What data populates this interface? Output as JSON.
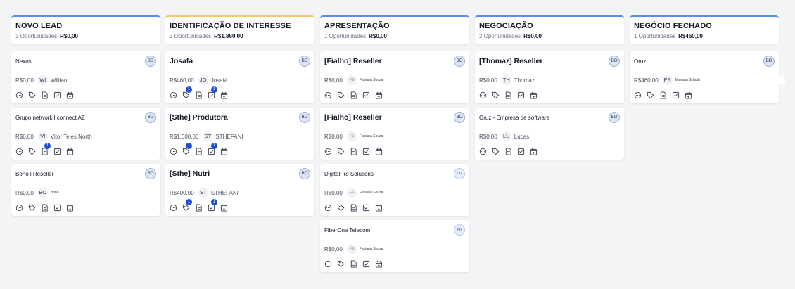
{
  "columns": [
    {
      "title": "NOVO LEAD",
      "count": "3 Oportunidades",
      "total": "R$0,00",
      "cards": [
        {
          "title": "Nexus",
          "big": false,
          "owner": "BD",
          "value": "R$0,00",
          "initials": "WI",
          "person": "Willian",
          "small": false,
          "badges": {}
        },
        {
          "title": "Grupo network l connect AZ",
          "big": false,
          "owner": "BD",
          "value": "R$0,00",
          "initials": "VI",
          "person": "Vitor Teles North",
          "small": false,
          "badges": {
            "doc": "1"
          }
        },
        {
          "title": "Bono l Reseller",
          "big": false,
          "owner": "BD",
          "value": "R$0,00",
          "initials": "BO",
          "person": "Bono",
          "small": false,
          "personSmall": true,
          "badges": {}
        }
      ]
    },
    {
      "title": "IDENTIFICAÇÃO DE INTERESSE",
      "count": "3 Oportunidades",
      "total": "R$1.860,00",
      "cards": [
        {
          "title": "Josafá",
          "big": true,
          "owner": "BD",
          "value": "R$460,00",
          "initials": "JO",
          "person": "Josafá",
          "small": false,
          "badges": {
            "tag": "1",
            "check": "1"
          }
        },
        {
          "title": "[Sthe] Produtora",
          "big": true,
          "owner": "BD",
          "value": "R$1.000,00",
          "initials": "ST",
          "person": "STHEFANI",
          "small": false,
          "badges": {
            "tag": "1",
            "check": "1"
          }
        },
        {
          "title": "[Sthe] Nutri",
          "big": true,
          "owner": "BD",
          "value": "R$400,00",
          "initials": "ST",
          "person": "STHEFANI",
          "small": false,
          "badges": {
            "tag": "1",
            "check": "1"
          }
        }
      ]
    },
    {
      "title": "APRESENTAÇÃO",
      "count": "1 Oportunidades",
      "total": "R$0,00",
      "cards": [
        {
          "title": "[Fialho] Reseller",
          "big": true,
          "owner": "BD",
          "value": "R$0,00",
          "initials": "FS",
          "person": "Fabiana Souza",
          "small": true,
          "badges": {}
        },
        {
          "title": "[Fialho] Reseller",
          "big": true,
          "owner": "BD",
          "value": "R$0,00",
          "initials": "FS",
          "person": "Fabiana Souza",
          "small": true,
          "badges": {}
        },
        {
          "title": "DigitalPro Solutions",
          "big": false,
          "owner": "DP",
          "ownerLight": true,
          "value": "R$0,00",
          "initials": "FS",
          "person": "Fabiana Souza",
          "small": true,
          "badges": {}
        },
        {
          "title": "FiberOne Telecom",
          "big": false,
          "owner": "FB",
          "ownerLight": true,
          "value": "R$0,00",
          "initials": "FS",
          "person": "Fabiana Souza",
          "small": true,
          "badges": {}
        }
      ]
    },
    {
      "title": "NEGOCIAÇÃO",
      "count": "2 Oportunidades",
      "total": "R$0,00",
      "cards": [
        {
          "title": "[Thomaz] Reseller",
          "big": true,
          "owner": "BD",
          "value": "R$0,00",
          "initials": "TH",
          "person": "Thomaz",
          "small": false,
          "badges": {}
        },
        {
          "title": "Oruz - Empresa de software",
          "big": false,
          "owner": "BD",
          "value": "R$0,00",
          "initials": "LU",
          "person": "Lucas",
          "small": false,
          "badges": {}
        }
      ]
    },
    {
      "title": "NEGÓCIO FECHADO",
      "count": "1 Oportunidades",
      "total": "R$460,00",
      "cards": [
        {
          "title": "Oruz",
          "big": false,
          "owner": "BD",
          "value": "R$460,00",
          "initials": "PR",
          "person": "Mariana Schultz",
          "small": false,
          "personSmall": true,
          "badges": {}
        }
      ]
    }
  ],
  "icons": [
    "chat-icon",
    "tag-icon",
    "document-icon",
    "checkbox-icon",
    "calendar-icon"
  ],
  "colors": {
    "accent": "#5b8def",
    "highlight": "#f3c969",
    "badge": "#1d4ed8"
  }
}
